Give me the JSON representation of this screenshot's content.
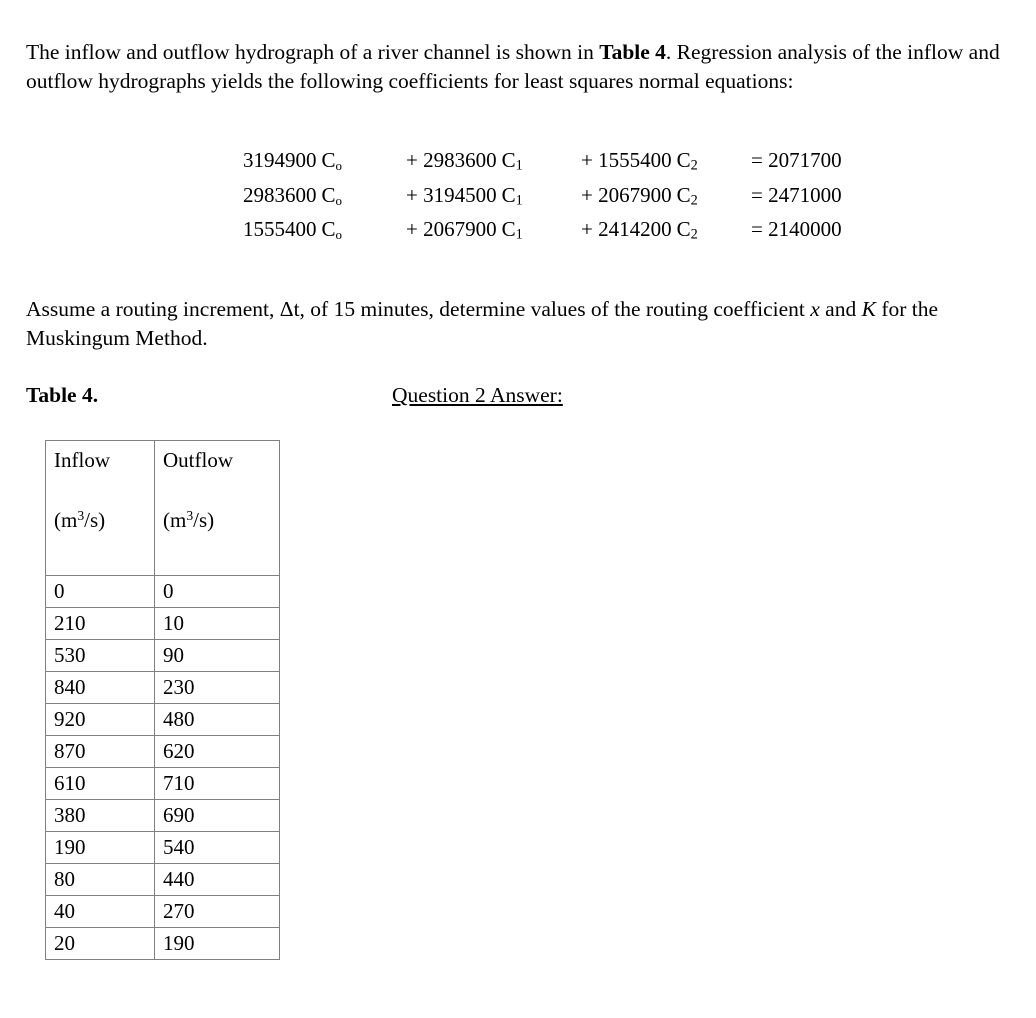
{
  "intro": {
    "text_before_bold": "The inflow and outflow hydrograph of a river channel is shown in ",
    "bold_ref": "Table 4",
    "text_after_bold": ". Regression analysis of the inflow and outflow hydrographs yields the following coefficients for least squares normal equations:"
  },
  "equations": {
    "rows": [
      {
        "c0_coeff": "3194900",
        "c0_var": "C",
        "c0_sub": "o",
        "c1_op": "+",
        "c1_coeff": "2983600",
        "c1_var": "C",
        "c1_sub": "1",
        "c2_op": "+",
        "c2_coeff": "1555400",
        "c2_var": "C",
        "c2_sub": "2",
        "eq_op": "=",
        "rhs": "2071700"
      },
      {
        "c0_coeff": "2983600",
        "c0_var": "C",
        "c0_sub": "o",
        "c1_op": "+",
        "c1_coeff": "3194500",
        "c1_var": "C",
        "c1_sub": "1",
        "c2_op": "+",
        "c2_coeff": "2067900",
        "c2_var": "C",
        "c2_sub": "2",
        "eq_op": "=",
        "rhs": "2471000"
      },
      {
        "c0_coeff": "1555400",
        "c0_var": "C",
        "c0_sub": "o",
        "c1_op": "+",
        "c1_coeff": "2067900",
        "c1_var": "C",
        "c1_sub": "1",
        "c2_op": "+",
        "c2_coeff": "2414200",
        "c2_var": "C",
        "c2_sub": "2",
        "eq_op": "=",
        "rhs": "2140000"
      }
    ]
  },
  "assume": {
    "part1": "Assume a routing increment, Δt, of 15 minutes, determine values of the routing coefficient ",
    "italic_x": "x",
    "part2": " and ",
    "italic_k": "K",
    "part3": " for the Muskingum Method."
  },
  "labels": {
    "table_caption": "Table 4.",
    "question_answer": "Question 2 Answer:"
  },
  "chart_data": {
    "type": "table",
    "title": "Table 4.",
    "columns": [
      {
        "name": "Inflow",
        "units": "(m3/s)"
      },
      {
        "name": "Outflow",
        "units": "(m3/s)"
      }
    ],
    "inflow_label": "Inflow",
    "inflow_units_prefix": "(m",
    "inflow_units_exp": "3",
    "inflow_units_suffix": "/s)",
    "outflow_label": "Outflow",
    "outflow_units_prefix": "(m",
    "outflow_units_exp": "3",
    "outflow_units_suffix": "/s)",
    "inflow": [
      0,
      210,
      530,
      840,
      920,
      870,
      610,
      380,
      190,
      80,
      40,
      20
    ],
    "outflow": [
      0,
      10,
      90,
      230,
      480,
      620,
      710,
      690,
      540,
      440,
      270,
      190
    ],
    "rows": [
      {
        "inflow": "0",
        "outflow": "0"
      },
      {
        "inflow": "210",
        "outflow": "10"
      },
      {
        "inflow": "530",
        "outflow": "90"
      },
      {
        "inflow": "840",
        "outflow": "230"
      },
      {
        "inflow": "920",
        "outflow": "480"
      },
      {
        "inflow": "870",
        "outflow": "620"
      },
      {
        "inflow": "610",
        "outflow": "710"
      },
      {
        "inflow": "380",
        "outflow": "690"
      },
      {
        "inflow": "190",
        "outflow": "540"
      },
      {
        "inflow": "80",
        "outflow": "440"
      },
      {
        "inflow": "40",
        "outflow": "270"
      },
      {
        "inflow": "20",
        "outflow": "190"
      }
    ]
  }
}
